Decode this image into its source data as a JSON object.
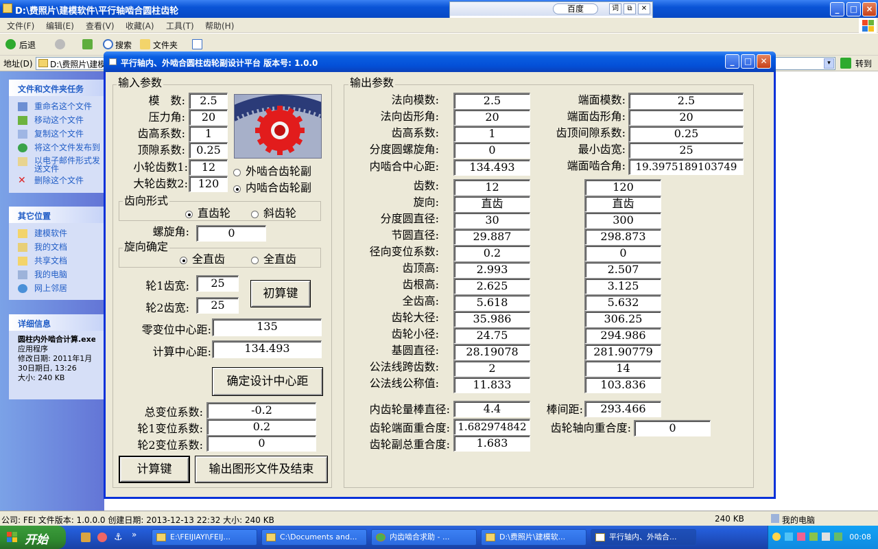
{
  "explorer": {
    "title": "D:\\费照片\\建模软件\\平行轴啮合圆柱齿轮",
    "menu": [
      "文件(F)",
      "编辑(E)",
      "查看(V)",
      "收藏(A)",
      "工具(T)",
      "帮助(H)"
    ],
    "toolbar": {
      "back": "后退",
      "search": "搜索",
      "folders": "文件夹"
    },
    "address_label": "地址(D)",
    "address_value": "D:\\费照片\\建模软件\\平行轴啮合圆柱齿轮",
    "goto": "转到",
    "baidu_label": "百度",
    "tasks_header": "文件和文件夹任务",
    "tasks": [
      "重命名这个文件",
      "移动这个文件",
      "复制这个文件",
      "将这个文件发布到",
      "以电子邮件形式发送文件",
      "删除这个文件"
    ],
    "places_header": "其它位置",
    "places": [
      "建模软件",
      "我的文档",
      "共享文档",
      "我的电脑",
      "网上邻居"
    ],
    "details_header": "详细信息",
    "details": {
      "name": "圆柱内外啮合计算.exe",
      "type": "应用程序",
      "modified": "修改日期: 2011年1月30日期日, 13:26",
      "size": "大小: 240 KB"
    },
    "status": {
      "left": "公司: FEI 文件版本: 1.0.0.0 创建日期: 2013-12-13 22:32 大小: 240 KB",
      "size": "240 KB",
      "location": "我的电脑"
    }
  },
  "taskbar": {
    "start": "开始",
    "tasks": [
      "E:\\FEIJIAYI\\FEIJ...",
      "C:\\Documents and...",
      "内齿啮合求助 - ...",
      "D:\\费照片\\建模软...",
      "平行轴内、外啮合..."
    ],
    "clock": "00:08"
  },
  "dialog": {
    "title": "平行轴内、外啮合圆柱齿轮副设计平台 版本号: 1.0.0",
    "input": {
      "group_title": "输入参数",
      "module": {
        "label": "模　数:",
        "value": "2.5"
      },
      "pressure_angle": {
        "label": "压力角:",
        "value": "20"
      },
      "addendum_coef": {
        "label": "齿高系数:",
        "value": "1"
      },
      "clearance_coef": {
        "label": "顶隙系数:",
        "value": "0.25"
      },
      "z1": {
        "label": "小轮齿数1:",
        "value": "12"
      },
      "z2": {
        "label": "大轮齿数2:",
        "value": "120"
      },
      "mesh_external": "外啮合齿轮副",
      "mesh_internal": "内啮合齿轮副",
      "tooth_form_title": "齿向形式",
      "spur": "直齿轮",
      "helical": "斜齿轮",
      "helix_angle": {
        "label": "螺旋角:",
        "value": "0"
      },
      "hand_title": "旋向确定",
      "hand_a": "全直齿",
      "hand_b": "全直齿",
      "width1": {
        "label": "轮1齿宽:",
        "value": "25"
      },
      "width2": {
        "label": "轮2齿宽:",
        "value": "25"
      },
      "precalc_button": "初算键",
      "zero_center": {
        "label": "零变位中心距:",
        "value": "135"
      },
      "calc_center": {
        "label": "计算中心距:",
        "value": "134.493"
      },
      "confirm_center_button": "确定设计中心距",
      "total_shift": {
        "label": "总变位系数:",
        "value": "-0.2"
      },
      "shift1": {
        "label": "轮1变位系数:",
        "value": "0.2"
      },
      "shift2": {
        "label": "轮2变位系数:",
        "value": "0"
      },
      "calc_button": "计算键",
      "output_button": "输出图形文件及结束"
    },
    "output": {
      "group_title": "输出参数",
      "normal_module": {
        "label": "法向模数:",
        "value": "2.5"
      },
      "normal_pressure": {
        "label": "法向齿形角:",
        "value": "20"
      },
      "addendum_coef": {
        "label": "齿高系数:",
        "value": "1"
      },
      "helix_angle": {
        "label": "分度圆螺旋角:",
        "value": "0"
      },
      "internal_center": {
        "label": "内啮合中心距:",
        "value": "134.493"
      },
      "transverse_module": {
        "label": "端面模数:",
        "value": "2.5"
      },
      "transverse_pressure": {
        "label": "端面齿形角:",
        "value": "20"
      },
      "tip_clearance": {
        "label": "齿顶间隙系数:",
        "value": "0.25"
      },
      "min_width": {
        "label": "最小齿宽:",
        "value": "25"
      },
      "transverse_mesh_angle": {
        "label": "端面啮合角:",
        "value": "19.3975189103749"
      },
      "rows": [
        {
          "label": "齿数:",
          "g1": "12",
          "g2": "120"
        },
        {
          "label": "旋向:",
          "g1": "直齿",
          "g2": "直齿"
        },
        {
          "label": "分度圆直径:",
          "g1": "30",
          "g2": "300"
        },
        {
          "label": "节圆直径:",
          "g1": "29.887",
          "g2": "298.873"
        },
        {
          "label": "径向变位系数:",
          "g1": "0.2",
          "g2": "0"
        },
        {
          "label": "齿顶高:",
          "g1": "2.993",
          "g2": "2.507"
        },
        {
          "label": "齿根高:",
          "g1": "2.625",
          "g2": "3.125"
        },
        {
          "label": "全齿高:",
          "g1": "5.618",
          "g2": "5.632"
        },
        {
          "label": "齿轮大径:",
          "g1": "35.986",
          "g2": "306.25"
        },
        {
          "label": "齿轮小径:",
          "g1": "24.75",
          "g2": "294.986"
        },
        {
          "label": "基圆直径:",
          "g1": "28.19078",
          "g2": "281.90779"
        },
        {
          "label": "公法线跨齿数:",
          "g1": "2",
          "g2": "14"
        },
        {
          "label": "公法线公称值:",
          "g1": "11.833",
          "g2": "103.836"
        }
      ],
      "pin_diameter": {
        "label": "内齿轮量棒直径:",
        "value": "4.4"
      },
      "pin_distance": {
        "label": "棒间距:",
        "value": "293.466"
      },
      "transverse_contact": {
        "label": "齿轮端面重合度:",
        "value": "1.682974842"
      },
      "axial_contact": {
        "label": "齿轮轴向重合度:",
        "value": "0"
      },
      "total_contact": {
        "label": "齿轮副总重合度:",
        "value": "1.683"
      }
    }
  }
}
